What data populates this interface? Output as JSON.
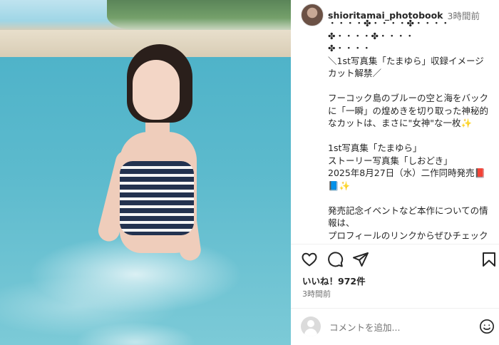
{
  "post": {
    "username": "shioritamai_photobook",
    "time": "3時間前",
    "caption": "・・・・✤・・・・✤・・・・✤・・・・✤・・・・\n✤・・・・\n＼1st写真集「たまゆら」収録イメージカット解禁／\n\nフーコック島のブルーの空と海をバックに「一瞬」の煌めきを切り取った神秘的なカットは、まさに\"女神\"な一枚✨\n\n1st写真集「たまゆら」\nストーリー写真集「しおどき」\n2025年8月27日（水）二作同時発売📕📘✨\n\n発売記念イベントなど本作についての情報は、\nプロフィールのリンクからぜひチェックしてみてください👆🔗",
    "likes": "いいね！972件",
    "posted_time": "3時間前",
    "comment_placeholder": "コメントを追加..."
  },
  "icons": {
    "like": "heart-icon",
    "comment": "comment-bubble-icon",
    "share": "send-icon",
    "save": "bookmark-icon",
    "emoji": "emoji-smile-icon"
  }
}
